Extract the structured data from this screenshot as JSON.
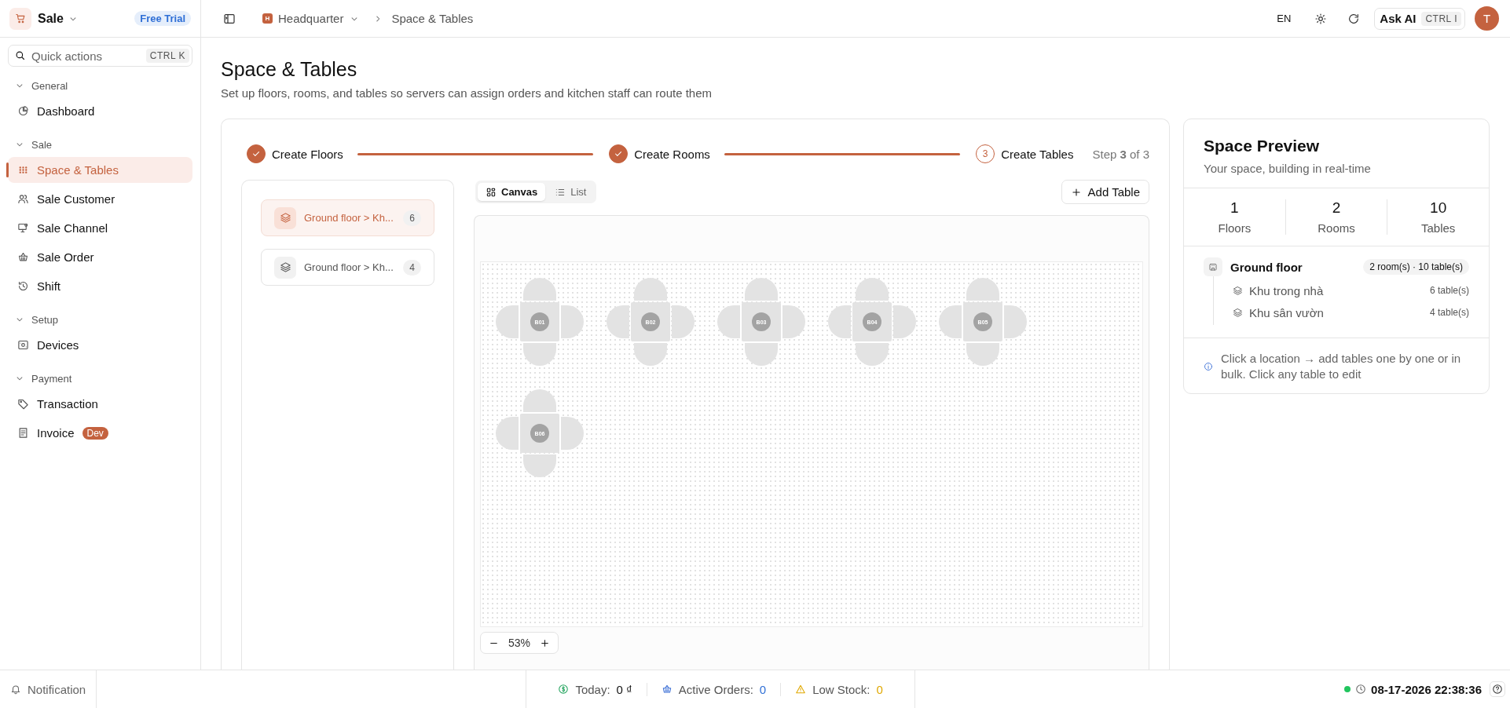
{
  "app": {
    "name": "Sale",
    "badge": "Free Trial"
  },
  "search": {
    "placeholder": "Quick actions",
    "shortcut": "CTRL K"
  },
  "sidebar": {
    "sections": [
      {
        "title": "General",
        "expanded": true,
        "items": [
          {
            "label": "Dashboard",
            "selected": false
          }
        ]
      },
      {
        "title": "Sale",
        "expanded": true,
        "items": [
          {
            "label": "Space & Tables",
            "selected": true
          },
          {
            "label": "Sale Customer",
            "selected": false
          },
          {
            "label": "Sale Channel",
            "selected": false
          },
          {
            "label": "Sale Order",
            "selected": false
          },
          {
            "label": "Shift",
            "selected": false
          }
        ]
      },
      {
        "title": "Setup",
        "expanded": true,
        "items": [
          {
            "label": "Devices",
            "selected": false
          }
        ]
      },
      {
        "title": "Payment",
        "expanded": true,
        "items": [
          {
            "label": "Transaction",
            "selected": false
          },
          {
            "label": "Invoice",
            "selected": false,
            "badge": "Dev"
          }
        ]
      }
    ]
  },
  "topbar": {
    "location": {
      "badge": "H",
      "label": "Headquarter"
    },
    "page": "Space & Tables",
    "language": "EN",
    "ask_ai": {
      "label": "Ask AI",
      "shortcut": "CTRL I"
    },
    "avatar": "T"
  },
  "page": {
    "title": "Space & Tables",
    "subtitle": "Set up floors, rooms, and tables so servers can assign orders and kitchen staff can route them"
  },
  "stepper": {
    "steps": [
      {
        "label": "Create Floors",
        "done": true
      },
      {
        "label": "Create Rooms",
        "done": true
      },
      {
        "label": "Create Tables",
        "number": "3",
        "done": false
      }
    ],
    "counter": "Step **3** of 3"
  },
  "rooms": [
    {
      "label": "Ground floor > Kh...",
      "count": "6",
      "selected": true
    },
    {
      "label": "Ground floor > Kh...",
      "count": "4",
      "selected": false
    }
  ],
  "view_toggle": [
    {
      "label": "Canvas",
      "selected": true
    },
    {
      "label": "List",
      "selected": false
    }
  ],
  "add_table": "Add Table",
  "tables": [
    {
      "label": "B01"
    },
    {
      "label": "B02"
    },
    {
      "label": "B03"
    },
    {
      "label": "B04"
    },
    {
      "label": "B05"
    },
    {
      "label": "B06"
    }
  ],
  "zoom": {
    "reading": "53%"
  },
  "preview": {
    "title": "Space Preview",
    "subtitle": "Your space, building in real-time",
    "stats": [
      {
        "value": "1",
        "label": "Floors"
      },
      {
        "value": "2",
        "label": "Rooms"
      },
      {
        "value": "10",
        "label": "Tables"
      }
    ],
    "floors": [
      {
        "name": "Ground floor",
        "summary": "2 room(s) · 10 table(s)",
        "children": [
          {
            "name": "Khu trong nhà",
            "count": "6 table(s)"
          },
          {
            "name": "Khu sân vườn",
            "count": "4 table(s)"
          }
        ]
      }
    ],
    "hint": "Click a location → add tables one by one or in bulk. Click any table to edit"
  },
  "status_bar": {
    "notification": "Notification",
    "metrics": [
      {
        "label": "Today:",
        "value": "0 ₫",
        "color": "#111111"
      },
      {
        "label": "Active Orders:",
        "value": "0",
        "color": "#2f6fd6"
      },
      {
        "label": "Low Stock:",
        "value": "0",
        "color": "#e0a800"
      }
    ],
    "online": true,
    "datetime": "08-17-2026 22:38:36"
  }
}
